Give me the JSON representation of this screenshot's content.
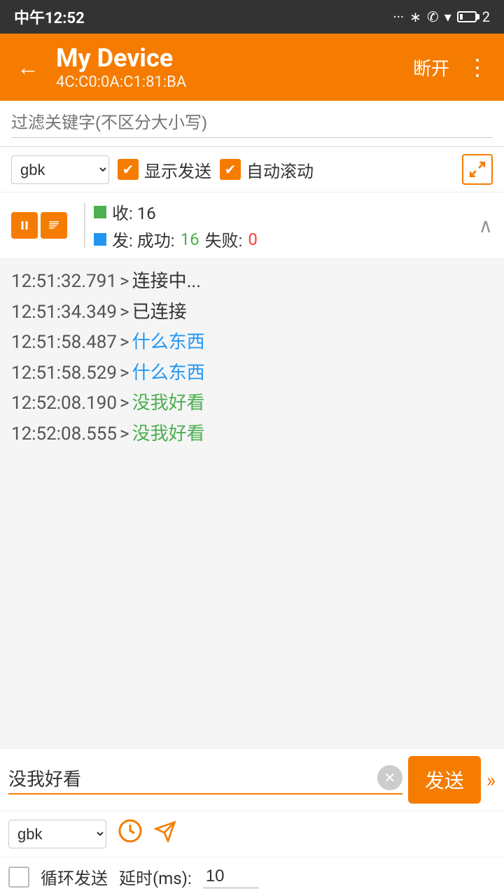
{
  "statusBar": {
    "time": "中午12:52",
    "battery": "2"
  },
  "header": {
    "deviceName": "My Device",
    "deviceMac": "4C:C0:0A:C1:81:BA",
    "disconnectLabel": "断开",
    "moreLabel": "⋮"
  },
  "filter": {
    "placeholder": "过滤关键字(不区分大小写)"
  },
  "controls": {
    "encoding": "gbk",
    "showSendLabel": "显示发送",
    "autoScrollLabel": "自动滚动"
  },
  "stats": {
    "recvLabel": "收: 16",
    "sendLabel": "发: 成功: 16 失败: 0",
    "successCount": "16",
    "failCount": "0"
  },
  "logs": [
    {
      "time": "12:51:32.791",
      "arrow": ">",
      "msg": "连接中...",
      "type": "default"
    },
    {
      "time": "12:51:34.349",
      "arrow": ">",
      "msg": "已连接",
      "type": "default"
    },
    {
      "time": "12:51:58.487",
      "arrow": ">",
      "msg": "什么东西",
      "type": "blue"
    },
    {
      "time": "12:51:58.529",
      "arrow": ">",
      "msg": "什么东西",
      "type": "blue"
    },
    {
      "time": "12:52:08.190",
      "arrow": ">",
      "msg": "没我好看",
      "type": "green"
    },
    {
      "time": "12:52:08.555",
      "arrow": ">",
      "msg": "没我好看",
      "type": "green"
    }
  ],
  "sendInput": {
    "value": "没我好看",
    "sendLabel": "发送"
  },
  "bottomOptions": {
    "encoding": "gbk"
  },
  "loopSend": {
    "label": "循环发送",
    "delayLabel": "延时(ms):",
    "delayValue": "10"
  }
}
